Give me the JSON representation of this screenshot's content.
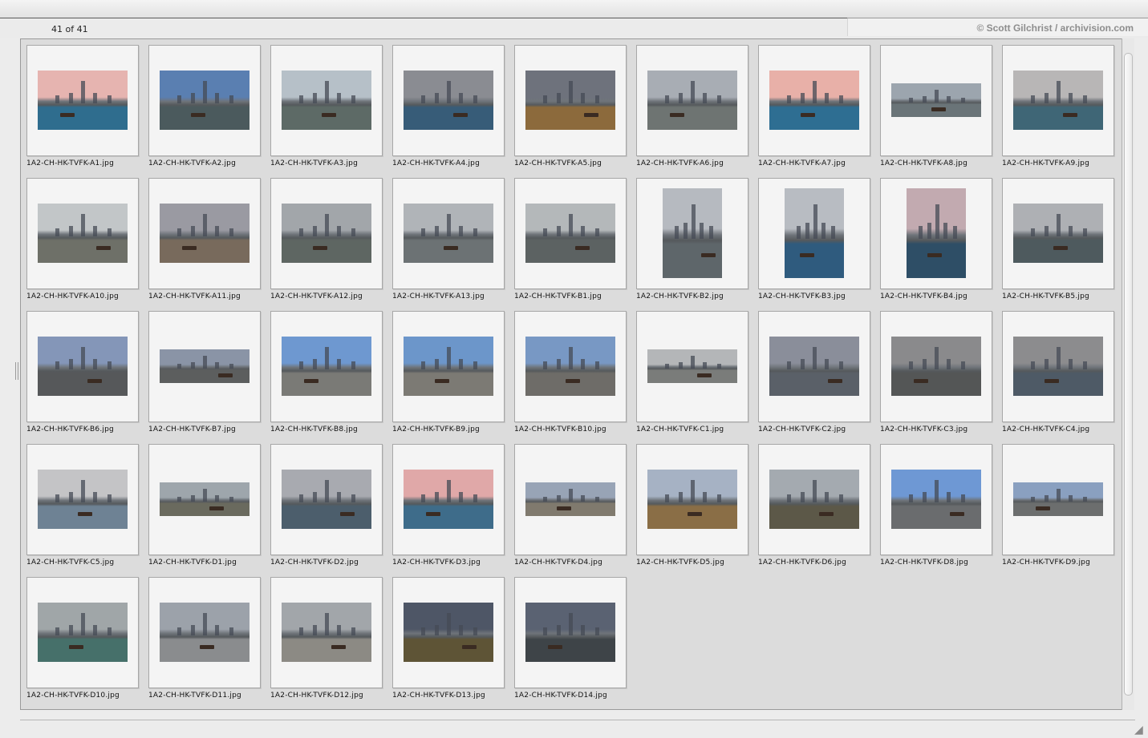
{
  "header": {
    "count": "41 of 41",
    "credit": "© Scott Gilchrist / archivision.com"
  },
  "thumbnails": [
    {
      "file": "1A2-CH-HK-TVFK-A1.jpg",
      "orientation": "landscape",
      "sky": "#e6b4b0",
      "water": "#2f6d8e"
    },
    {
      "file": "1A2-CH-HK-TVFK-A2.jpg",
      "orientation": "landscape",
      "sky": "#5a7fb1",
      "water": "#4b5a5d"
    },
    {
      "file": "1A2-CH-HK-TVFK-A3.jpg",
      "orientation": "landscape",
      "sky": "#b6c0c8",
      "water": "#5d6a66"
    },
    {
      "file": "1A2-CH-HK-TVFK-A4.jpg",
      "orientation": "landscape",
      "sky": "#8a8c92",
      "water": "#375c78"
    },
    {
      "file": "1A2-CH-HK-TVFK-A5.jpg",
      "orientation": "landscape",
      "sky": "#6e727c",
      "water": "#8c6a3c"
    },
    {
      "file": "1A2-CH-HK-TVFK-A6.jpg",
      "orientation": "landscape",
      "sky": "#a8adb4",
      "water": "#6e7472"
    },
    {
      "file": "1A2-CH-HK-TVFK-A7.jpg",
      "orientation": "landscape",
      "sky": "#e8b0a8",
      "water": "#2e6e92"
    },
    {
      "file": "1A2-CH-HK-TVFK-A8.jpg",
      "orientation": "wide",
      "sky": "#9ca5ae",
      "water": "#6a7478"
    },
    {
      "file": "1A2-CH-HK-TVFK-A9.jpg",
      "orientation": "landscape",
      "sky": "#b8b6b6",
      "water": "#3f6676"
    },
    {
      "file": "1A2-CH-HK-TVFK-A10.jpg",
      "orientation": "landscape",
      "sky": "#c2c6c8",
      "water": "#6e7068"
    },
    {
      "file": "1A2-CH-HK-TVFK-A11.jpg",
      "orientation": "landscape",
      "sky": "#9a9aa2",
      "water": "#786a5c"
    },
    {
      "file": "1A2-CH-HK-TVFK-A12.jpg",
      "orientation": "landscape",
      "sky": "#a2a6aa",
      "water": "#5e6662"
    },
    {
      "file": "1A2-CH-HK-TVFK-A13.jpg",
      "orientation": "landscape",
      "sky": "#b0b4b8",
      "water": "#6c7274"
    },
    {
      "file": "1A2-CH-HK-TVFK-B1.jpg",
      "orientation": "landscape",
      "sky": "#b4b8ba",
      "water": "#5c6262"
    },
    {
      "file": "1A2-CH-HK-TVFK-B2.jpg",
      "orientation": "portrait",
      "sky": "#b6bac0",
      "water": "#5e666a"
    },
    {
      "file": "1A2-CH-HK-TVFK-B3.jpg",
      "orientation": "portrait",
      "sky": "#b8bcc2",
      "water": "#2f5b7e"
    },
    {
      "file": "1A2-CH-HK-TVFK-B4.jpg",
      "orientation": "portrait",
      "sky": "#c2aab0",
      "water": "#2e4e66"
    },
    {
      "file": "1A2-CH-HK-TVFK-B5.jpg",
      "orientation": "landscape",
      "sky": "#aeb0b4",
      "water": "#4e5a5e"
    },
    {
      "file": "1A2-CH-HK-TVFK-B6.jpg",
      "orientation": "landscape",
      "sky": "#8496b8",
      "water": "#56585a"
    },
    {
      "file": "1A2-CH-HK-TVFK-B7.jpg",
      "orientation": "wide",
      "sky": "#8a94a6",
      "water": "#5c5e5e"
    },
    {
      "file": "1A2-CH-HK-TVFK-B8.jpg",
      "orientation": "landscape",
      "sky": "#6e98d0",
      "water": "#7a7a76"
    },
    {
      "file": "1A2-CH-HK-TVFK-B9.jpg",
      "orientation": "landscape",
      "sky": "#6c96ca",
      "water": "#7c7a74"
    },
    {
      "file": "1A2-CH-HK-TVFK-B10.jpg",
      "orientation": "landscape",
      "sky": "#7898c4",
      "water": "#6e6c68"
    },
    {
      "file": "1A2-CH-HK-TVFK-C1.jpg",
      "orientation": "wide",
      "sky": "#b4b6b8",
      "water": "#7a7c7a"
    },
    {
      "file": "1A2-CH-HK-TVFK-C2.jpg",
      "orientation": "landscape",
      "sky": "#8a8e9a",
      "water": "#5a6068"
    },
    {
      "file": "1A2-CH-HK-TVFK-C3.jpg",
      "orientation": "landscape",
      "sky": "#8a8a8c",
      "water": "#545656"
    },
    {
      "file": "1A2-CH-HK-TVFK-C4.jpg",
      "orientation": "landscape",
      "sky": "#8c8c8e",
      "water": "#4e5a66"
    },
    {
      "file": "1A2-CH-HK-TVFK-C5.jpg",
      "orientation": "landscape",
      "sky": "#c4c4c6",
      "water": "#6e8294"
    },
    {
      "file": "1A2-CH-HK-TVFK-D1.jpg",
      "orientation": "wide",
      "sky": "#9ea6ac",
      "water": "#6a6a5e"
    },
    {
      "file": "1A2-CH-HK-TVFK-D2.jpg",
      "orientation": "landscape",
      "sky": "#a8aab0",
      "water": "#4c5e6c"
    },
    {
      "file": "1A2-CH-HK-TVFK-D3.jpg",
      "orientation": "landscape",
      "sky": "#e0a8a8",
      "water": "#3e6c8a"
    },
    {
      "file": "1A2-CH-HK-TVFK-D4.jpg",
      "orientation": "wide",
      "sky": "#98a4b6",
      "water": "#807a6e"
    },
    {
      "file": "1A2-CH-HK-TVFK-D5.jpg",
      "orientation": "landscape",
      "sky": "#a6b2c4",
      "water": "#8a6e46"
    },
    {
      "file": "1A2-CH-HK-TVFK-D6.jpg",
      "orientation": "landscape",
      "sky": "#a4aab0",
      "water": "#5c5848"
    },
    {
      "file": "1A2-CH-HK-TVFK-D8.jpg",
      "orientation": "landscape",
      "sky": "#6e98d4",
      "water": "#6a6c6e"
    },
    {
      "file": "1A2-CH-HK-TVFK-D9.jpg",
      "orientation": "wide",
      "sky": "#8aa0c0",
      "water": "#6c6e6e"
    },
    {
      "file": "1A2-CH-HK-TVFK-D10.jpg",
      "orientation": "landscape",
      "sky": "#a0a6a8",
      "water": "#46706a"
    },
    {
      "file": "1A2-CH-HK-TVFK-D11.jpg",
      "orientation": "landscape",
      "sky": "#9ca2aa",
      "water": "#8a8c8e"
    },
    {
      "file": "1A2-CH-HK-TVFK-D12.jpg",
      "orientation": "landscape",
      "sky": "#a2a6aa",
      "water": "#8c8a84"
    },
    {
      "file": "1A2-CH-HK-TVFK-D13.jpg",
      "orientation": "landscape",
      "sky": "#4e5666",
      "water": "#5e5436"
    },
    {
      "file": "1A2-CH-HK-TVFK-D14.jpg",
      "orientation": "landscape",
      "sky": "#5a6272",
      "water": "#3e4448"
    }
  ]
}
